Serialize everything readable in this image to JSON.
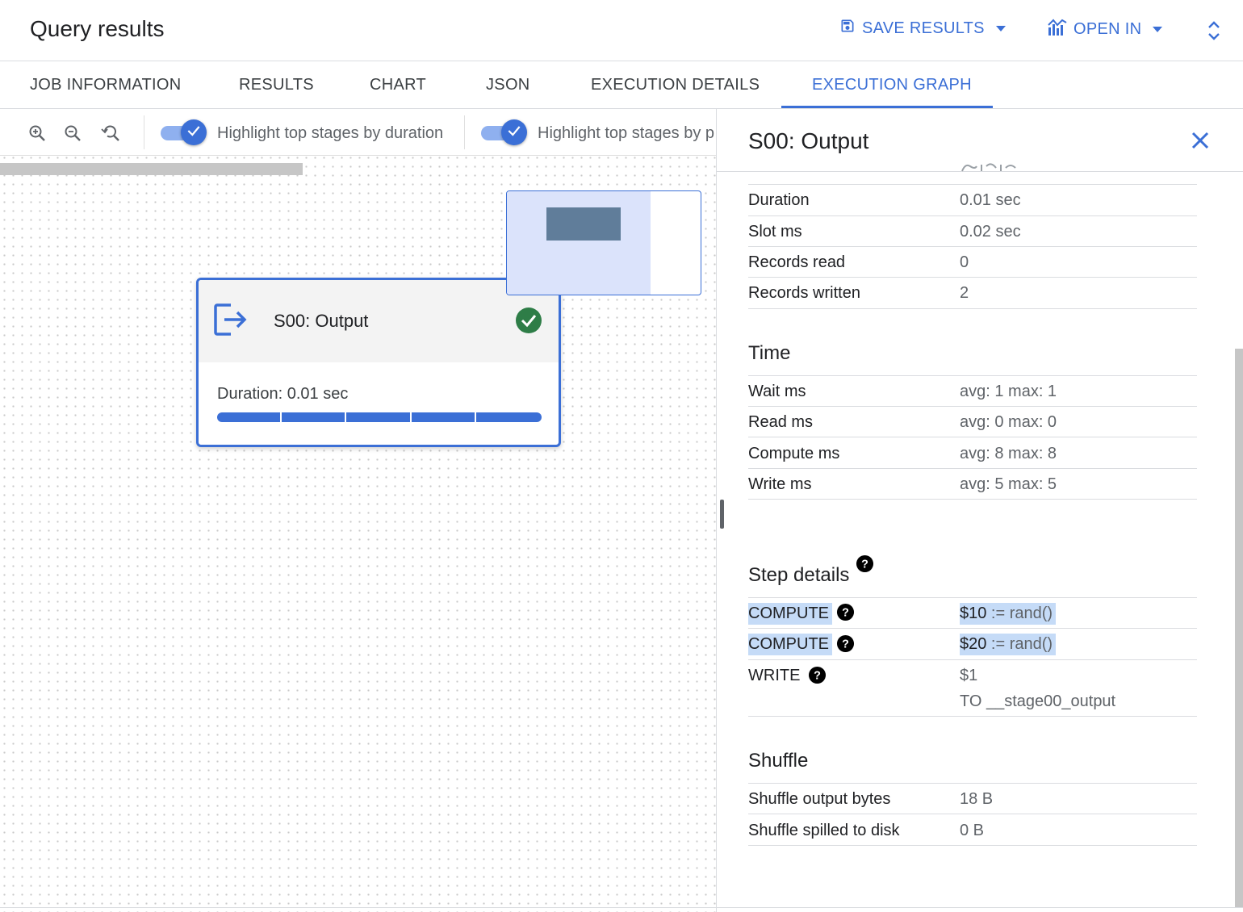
{
  "header": {
    "title": "Query results",
    "save_results": "SAVE RESULTS",
    "open_in": "OPEN IN"
  },
  "tabs": [
    {
      "label": "JOB INFORMATION"
    },
    {
      "label": "RESULTS"
    },
    {
      "label": "CHART"
    },
    {
      "label": "JSON"
    },
    {
      "label": "EXECUTION DETAILS"
    },
    {
      "label": "EXECUTION GRAPH",
      "active": true
    }
  ],
  "graph": {
    "toggle1_label": "Highlight top stages by duration",
    "toggle1_on": true,
    "toggle2_label": "Highlight top stages by p",
    "toggle2_on": true,
    "stage": {
      "name": "S00: Output",
      "duration": "Duration: 0.01 sec",
      "status": "complete"
    }
  },
  "detail": {
    "title": "S00: Output",
    "stats": [
      {
        "key": "Duration",
        "value": "0.01 sec"
      },
      {
        "key": "Slot ms",
        "value": "0.02 sec"
      },
      {
        "key": "Records read",
        "value": "0"
      },
      {
        "key": "Records written",
        "value": "2"
      }
    ],
    "time_title": "Time",
    "time": [
      {
        "key": "Wait ms",
        "value": "avg: 1 max: 1"
      },
      {
        "key": "Read ms",
        "value": "avg: 0 max: 0"
      },
      {
        "key": "Compute ms",
        "value": "avg: 8 max: 8"
      },
      {
        "key": "Write ms",
        "value": "avg: 5 max: 5"
      }
    ],
    "steps_title": "Step details",
    "steps": [
      {
        "key": "COMPUTE",
        "value_hl": "$10",
        "value_rest": " := rand()"
      },
      {
        "key": "COMPUTE",
        "value_hl": "$20",
        "value_rest": " := rand()"
      },
      {
        "key": "WRITE",
        "value_line1": "$1",
        "value_line2": "TO __stage00_output"
      }
    ],
    "shuffle_title": "Shuffle",
    "shuffle": [
      {
        "key": "Shuffle output bytes",
        "value": "18 B"
      },
      {
        "key": "Shuffle spilled to disk",
        "value": "0 B"
      }
    ]
  },
  "colors": {
    "accent": "#3b6fd6",
    "success": "#34a853",
    "highlight": "#c5dbf7"
  },
  "icons": [
    "save-icon",
    "chart-icon",
    "expand-icon",
    "zoom-in-icon",
    "zoom-out-icon",
    "zoom-reset-icon",
    "check-icon",
    "output-icon",
    "check-circle-icon",
    "close-icon",
    "help-icon"
  ]
}
